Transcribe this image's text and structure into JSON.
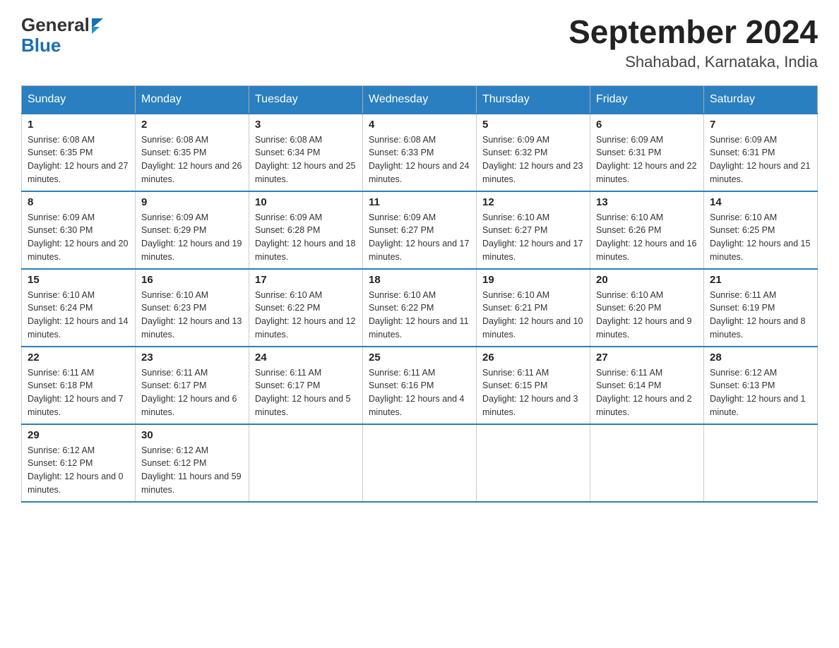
{
  "header": {
    "title": "September 2024",
    "subtitle": "Shahabad, Karnataka, India",
    "logo_general": "General",
    "logo_blue": "Blue"
  },
  "days_of_week": [
    "Sunday",
    "Monday",
    "Tuesday",
    "Wednesday",
    "Thursday",
    "Friday",
    "Saturday"
  ],
  "weeks": [
    [
      {
        "day": "1",
        "sunrise": "6:08 AM",
        "sunset": "6:35 PM",
        "daylight": "12 hours and 27 minutes."
      },
      {
        "day": "2",
        "sunrise": "6:08 AM",
        "sunset": "6:35 PM",
        "daylight": "12 hours and 26 minutes."
      },
      {
        "day": "3",
        "sunrise": "6:08 AM",
        "sunset": "6:34 PM",
        "daylight": "12 hours and 25 minutes."
      },
      {
        "day": "4",
        "sunrise": "6:08 AM",
        "sunset": "6:33 PM",
        "daylight": "12 hours and 24 minutes."
      },
      {
        "day": "5",
        "sunrise": "6:09 AM",
        "sunset": "6:32 PM",
        "daylight": "12 hours and 23 minutes."
      },
      {
        "day": "6",
        "sunrise": "6:09 AM",
        "sunset": "6:31 PM",
        "daylight": "12 hours and 22 minutes."
      },
      {
        "day": "7",
        "sunrise": "6:09 AM",
        "sunset": "6:31 PM",
        "daylight": "12 hours and 21 minutes."
      }
    ],
    [
      {
        "day": "8",
        "sunrise": "6:09 AM",
        "sunset": "6:30 PM",
        "daylight": "12 hours and 20 minutes."
      },
      {
        "day": "9",
        "sunrise": "6:09 AM",
        "sunset": "6:29 PM",
        "daylight": "12 hours and 19 minutes."
      },
      {
        "day": "10",
        "sunrise": "6:09 AM",
        "sunset": "6:28 PM",
        "daylight": "12 hours and 18 minutes."
      },
      {
        "day": "11",
        "sunrise": "6:09 AM",
        "sunset": "6:27 PM",
        "daylight": "12 hours and 17 minutes."
      },
      {
        "day": "12",
        "sunrise": "6:10 AM",
        "sunset": "6:27 PM",
        "daylight": "12 hours and 17 minutes."
      },
      {
        "day": "13",
        "sunrise": "6:10 AM",
        "sunset": "6:26 PM",
        "daylight": "12 hours and 16 minutes."
      },
      {
        "day": "14",
        "sunrise": "6:10 AM",
        "sunset": "6:25 PM",
        "daylight": "12 hours and 15 minutes."
      }
    ],
    [
      {
        "day": "15",
        "sunrise": "6:10 AM",
        "sunset": "6:24 PM",
        "daylight": "12 hours and 14 minutes."
      },
      {
        "day": "16",
        "sunrise": "6:10 AM",
        "sunset": "6:23 PM",
        "daylight": "12 hours and 13 minutes."
      },
      {
        "day": "17",
        "sunrise": "6:10 AM",
        "sunset": "6:22 PM",
        "daylight": "12 hours and 12 minutes."
      },
      {
        "day": "18",
        "sunrise": "6:10 AM",
        "sunset": "6:22 PM",
        "daylight": "12 hours and 11 minutes."
      },
      {
        "day": "19",
        "sunrise": "6:10 AM",
        "sunset": "6:21 PM",
        "daylight": "12 hours and 10 minutes."
      },
      {
        "day": "20",
        "sunrise": "6:10 AM",
        "sunset": "6:20 PM",
        "daylight": "12 hours and 9 minutes."
      },
      {
        "day": "21",
        "sunrise": "6:11 AM",
        "sunset": "6:19 PM",
        "daylight": "12 hours and 8 minutes."
      }
    ],
    [
      {
        "day": "22",
        "sunrise": "6:11 AM",
        "sunset": "6:18 PM",
        "daylight": "12 hours and 7 minutes."
      },
      {
        "day": "23",
        "sunrise": "6:11 AM",
        "sunset": "6:17 PM",
        "daylight": "12 hours and 6 minutes."
      },
      {
        "day": "24",
        "sunrise": "6:11 AM",
        "sunset": "6:17 PM",
        "daylight": "12 hours and 5 minutes."
      },
      {
        "day": "25",
        "sunrise": "6:11 AM",
        "sunset": "6:16 PM",
        "daylight": "12 hours and 4 minutes."
      },
      {
        "day": "26",
        "sunrise": "6:11 AM",
        "sunset": "6:15 PM",
        "daylight": "12 hours and 3 minutes."
      },
      {
        "day": "27",
        "sunrise": "6:11 AM",
        "sunset": "6:14 PM",
        "daylight": "12 hours and 2 minutes."
      },
      {
        "day": "28",
        "sunrise": "6:12 AM",
        "sunset": "6:13 PM",
        "daylight": "12 hours and 1 minute."
      }
    ],
    [
      {
        "day": "29",
        "sunrise": "6:12 AM",
        "sunset": "6:12 PM",
        "daylight": "12 hours and 0 minutes."
      },
      {
        "day": "30",
        "sunrise": "6:12 AM",
        "sunset": "6:12 PM",
        "daylight": "11 hours and 59 minutes."
      },
      null,
      null,
      null,
      null,
      null
    ]
  ]
}
